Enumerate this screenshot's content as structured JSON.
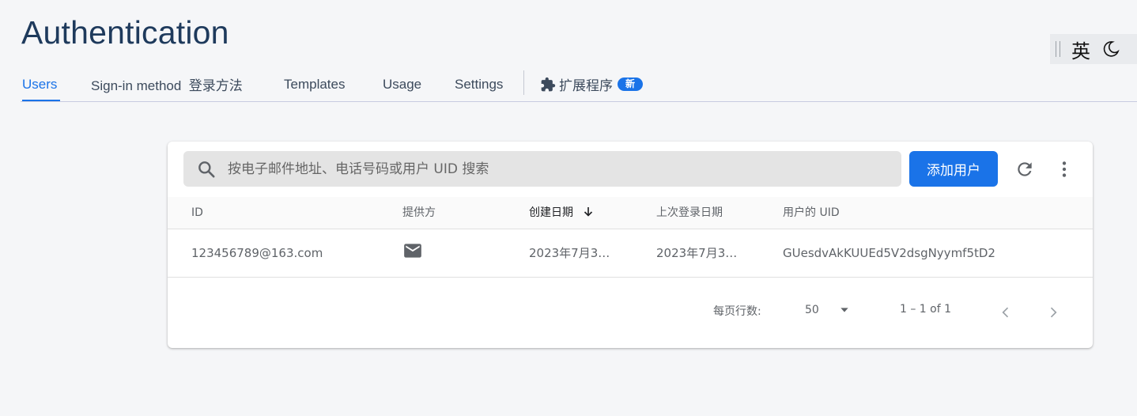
{
  "header": {
    "title": "Authentication"
  },
  "ime": {
    "language": "英",
    "icons": [
      "grip-icon",
      "moon-icon"
    ]
  },
  "tabs": [
    {
      "label": "Users",
      "active": true
    },
    {
      "label": "Sign-in method  登录方法",
      "active": false
    },
    {
      "label": "Templates",
      "active": false
    },
    {
      "label": "Usage",
      "active": false
    },
    {
      "label": "Settings",
      "active": false
    },
    {
      "label": "扩展程序",
      "active": false,
      "icon": "extension-icon",
      "badge": "新"
    }
  ],
  "toolbar": {
    "search_placeholder": "按电子邮件地址、电话号码或用户 UID 搜索",
    "add_user_label": "添加用户",
    "icons": [
      "search-icon",
      "refresh-icon",
      "more-vert-icon"
    ]
  },
  "table": {
    "columns": [
      {
        "label": "ID"
      },
      {
        "label": "提供方"
      },
      {
        "label": "创建日期",
        "sorted": "descending"
      },
      {
        "label": "上次登录日期"
      },
      {
        "label": "用户的 UID"
      }
    ],
    "rows": [
      {
        "id": "123456789@163.com",
        "provider_icon": "mail-icon",
        "created": "2023年7月3…",
        "last_sign_in": "2023年7月3…",
        "uid": "GUesdvAkKUUEd5V2dsgNyymf5tD2"
      }
    ]
  },
  "pagination": {
    "rows_per_page_label": "每页行数:",
    "rows_per_page_value": "50",
    "range_label": "1 – 1 of 1"
  },
  "colors": {
    "accent": "#1a73e8",
    "title": "#1e3a5c",
    "background": "#f5f6f8"
  }
}
